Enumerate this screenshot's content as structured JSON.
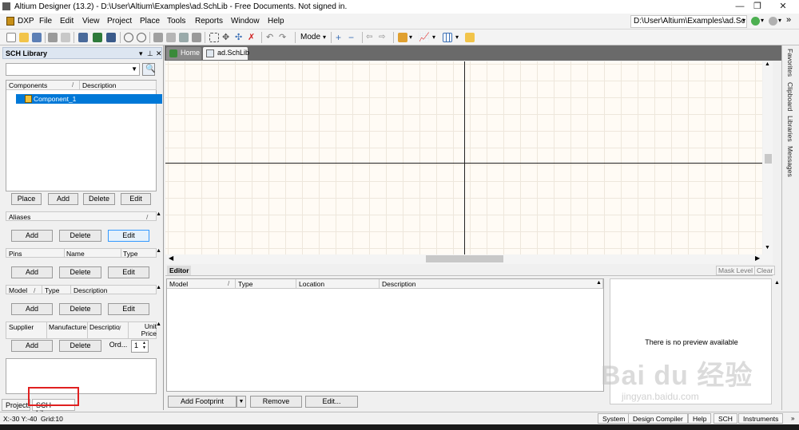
{
  "titlebar": {
    "title": "Altium Designer (13.2) - D:\\User\\Altium\\Examples\\ad.SchLib - Free Documents. Not signed in."
  },
  "menubar": {
    "items": [
      "DXP",
      "File",
      "Edit",
      "View",
      "Project",
      "Place",
      "Tools",
      "Reports",
      "Window",
      "Help"
    ],
    "path": "D:\\User\\Altium\\Examples\\ad.Sc"
  },
  "toolbar": {
    "mode_label": "Mode"
  },
  "panel": {
    "title": "SCH Library",
    "components": {
      "headers": [
        "Components",
        "Description"
      ],
      "rows": [
        "Component_1"
      ],
      "buttons": [
        "Place",
        "Add",
        "Delete",
        "Edit"
      ]
    },
    "aliases": {
      "header": "Aliases",
      "buttons": [
        "Add",
        "Delete",
        "Edit"
      ]
    },
    "pins": {
      "headers": [
        "Pins",
        "Name",
        "Type"
      ],
      "buttons": [
        "Add",
        "Delete",
        "Edit"
      ]
    },
    "model": {
      "headers": [
        "Model",
        "Type",
        "Description"
      ],
      "buttons": [
        "Add",
        "Delete",
        "Edit"
      ]
    },
    "supplier": {
      "headers": [
        "Supplier",
        "Manufacture",
        "Descriptio",
        "Unit Price"
      ],
      "buttons": [
        "Add",
        "Delete",
        "Ord..."
      ],
      "spinner_value": "1"
    },
    "tabs": [
      "Projects",
      "SCH Library"
    ]
  },
  "doc_tabs": [
    "Home",
    "ad.SchLib"
  ],
  "editor": {
    "tab_label": "Editor",
    "mask_level": "Mask Level",
    "clear": "Clear",
    "headers": [
      "Model",
      "Type",
      "Location",
      "Description"
    ],
    "buttons": [
      "Add Footprint",
      "Remove",
      "Edit..."
    ],
    "preview_text": "There is no preview available"
  },
  "right_tabs": [
    "Favorites",
    "Clipboard",
    "Libraries",
    "Messages"
  ],
  "status": {
    "coords": "X:-30 Y:-40",
    "grid": "Grid:10",
    "buttons": [
      "System",
      "Design Compiler",
      "Help",
      "SCH",
      "Instruments"
    ]
  },
  "watermark": "Bai du 经验",
  "watermark_sub": "jingyan.baidu.com",
  "colors": {
    "selection": "#0078d7",
    "highlight_box": "#e02020",
    "canvas_bg": "#fffbf5"
  }
}
